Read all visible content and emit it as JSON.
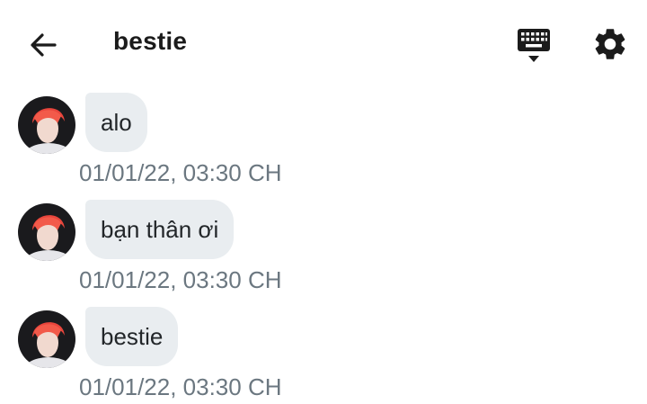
{
  "header": {
    "title": "bestie",
    "back_icon": "arrow-left-icon",
    "keyboard_icon": "keyboard-hide-icon",
    "settings_icon": "gear-icon"
  },
  "messages": [
    {
      "text": "alo",
      "time": "01/01/22, 03:30 CH"
    },
    {
      "text": "bạn thân ơi",
      "time": "01/01/22, 03:30 CH"
    },
    {
      "text": "bestie",
      "time": "01/01/22, 03:30 CH"
    }
  ],
  "colors": {
    "bubble": "#e9edf0",
    "timestamp": "#6b7780",
    "avatar_hair": "#e8453c"
  }
}
